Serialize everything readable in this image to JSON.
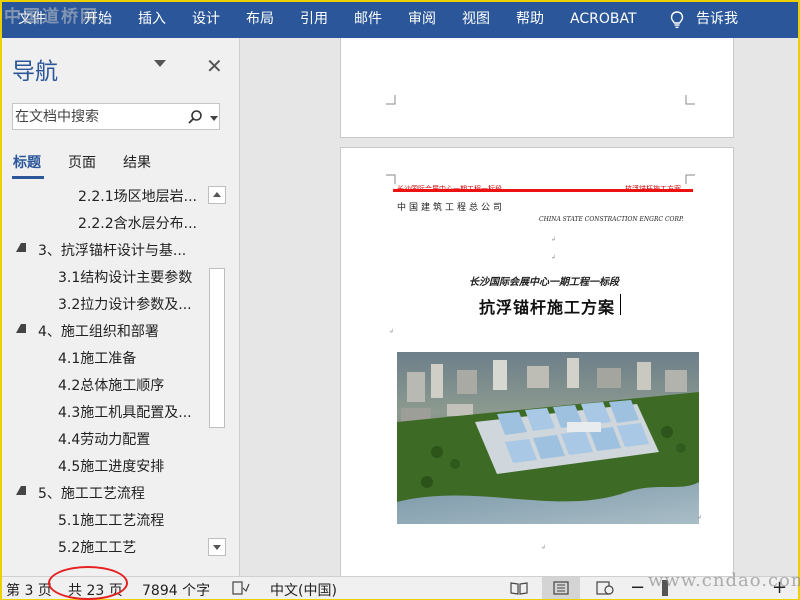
{
  "watermark_top": "中国道桥网",
  "watermark_bottom": "www.cndao.com",
  "ribbon": {
    "tabs": [
      "文件",
      "开始",
      "插入",
      "设计",
      "布局",
      "引用",
      "邮件",
      "审阅",
      "视图",
      "帮助",
      "ACROBAT"
    ],
    "tell_me": "告诉我"
  },
  "nav": {
    "title": "导航",
    "search_placeholder": "在文档中搜索",
    "tabs": [
      "标题",
      "页面",
      "结果"
    ],
    "tree": [
      {
        "label": "2.2.1场区地层岩...",
        "level": 2,
        "expanded": false
      },
      {
        "label": "2.2.2含水层分布...",
        "level": 2,
        "expanded": false
      },
      {
        "label": "3、抗浮锚杆设计与基...",
        "level": 0,
        "expanded": true
      },
      {
        "label": "3.1结构设计主要参数",
        "level": 1,
        "expanded": false
      },
      {
        "label": "3.2拉力设计参数及...",
        "level": 1,
        "expanded": false
      },
      {
        "label": "4、施工组织和部署",
        "level": 0,
        "expanded": true
      },
      {
        "label": "4.1施工准备",
        "level": 1,
        "expanded": false
      },
      {
        "label": "4.2总体施工顺序",
        "level": 1,
        "expanded": false
      },
      {
        "label": "4.3施工机具配置及...",
        "level": 1,
        "expanded": false
      },
      {
        "label": "4.4劳动力配置",
        "level": 1,
        "expanded": false
      },
      {
        "label": "4.5施工进度安排",
        "level": 1,
        "expanded": false
      },
      {
        "label": "5、施工工艺流程",
        "level": 0,
        "expanded": true
      },
      {
        "label": "5.1施工工艺流程",
        "level": 1,
        "expanded": false
      },
      {
        "label": "5.2施工工艺",
        "level": 1,
        "expanded": false
      }
    ]
  },
  "document": {
    "header_left": "长沙国际会展中心一期工程一标段",
    "header_right": "抗浮锚杆施工方案",
    "company": "中国建筑工程总公司",
    "company_en": "CHINA STATE CONSTRACTION ENGRC CORP.",
    "project": "长沙国际会展中心一期工程一标段",
    "title": "抗浮锚杆施工方案"
  },
  "status": {
    "page": "第 3 页",
    "total": "共 23 页",
    "words": "7894 个字",
    "language": "中文(中国)"
  },
  "colors": {
    "ribbon": "#2b579a",
    "frame": "#ecd000",
    "header_red": "#e11111"
  }
}
